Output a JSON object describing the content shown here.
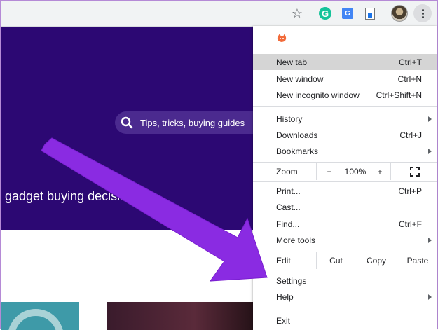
{
  "search": {
    "placeholder": "Tips, tricks, buying guides"
  },
  "hero": {
    "subtitle": "gadget buying decisions."
  },
  "toolbar": {
    "icons": [
      "star-icon",
      "grammarly-icon",
      "translate-icon",
      "png-download-icon",
      "profile-avatar",
      "more-icon"
    ],
    "grammarly_letter": "G",
    "translate_letter": "G"
  },
  "menu": {
    "new_tab": {
      "label": "New tab",
      "shortcut": "Ctrl+T"
    },
    "new_window": {
      "label": "New window",
      "shortcut": "Ctrl+N"
    },
    "new_incognito": {
      "label": "New incognito window",
      "shortcut": "Ctrl+Shift+N"
    },
    "history": {
      "label": "History"
    },
    "downloads": {
      "label": "Downloads",
      "shortcut": "Ctrl+J"
    },
    "bookmarks": {
      "label": "Bookmarks"
    },
    "zoom": {
      "label": "Zoom",
      "minus": "−",
      "value": "100%",
      "plus": "+"
    },
    "print": {
      "label": "Print...",
      "shortcut": "Ctrl+P"
    },
    "cast": {
      "label": "Cast..."
    },
    "find": {
      "label": "Find...",
      "shortcut": "Ctrl+F"
    },
    "more_tools": {
      "label": "More tools"
    },
    "edit": {
      "label": "Edit",
      "cut": "Cut",
      "copy": "Copy",
      "paste": "Paste"
    },
    "settings": {
      "label": "Settings"
    },
    "help": {
      "label": "Help"
    },
    "exit": {
      "label": "Exit"
    }
  },
  "colors": {
    "hero_bg": "#2c0873",
    "highlight": "#d5d5d5",
    "arrow": "#8a2be2"
  }
}
